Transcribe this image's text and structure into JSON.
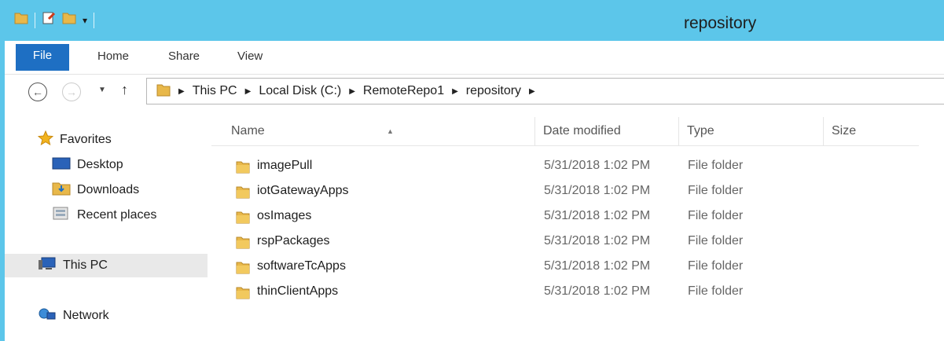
{
  "window": {
    "title": "repository"
  },
  "ribbon": {
    "tabs": [
      "File",
      "Home",
      "Share",
      "View"
    ]
  },
  "address": {
    "breadcrumb": [
      "This PC",
      "Local Disk (C:)",
      "RemoteRepo1",
      "repository"
    ]
  },
  "nav": {
    "favorites": "Favorites",
    "desktop": "Desktop",
    "downloads": "Downloads",
    "recent": "Recent places",
    "this_pc": "This PC",
    "network": "Network"
  },
  "columns": {
    "name": "Name",
    "date": "Date modified",
    "type": "Type",
    "size": "Size"
  },
  "files": [
    {
      "name": "imagePull",
      "date": "5/31/2018 1:02 PM",
      "type": "File folder"
    },
    {
      "name": "iotGatewayApps",
      "date": "5/31/2018 1:02 PM",
      "type": "File folder"
    },
    {
      "name": "osImages",
      "date": "5/31/2018 1:02 PM",
      "type": "File folder"
    },
    {
      "name": "rspPackages",
      "date": "5/31/2018 1:02 PM",
      "type": "File folder"
    },
    {
      "name": "softwareTcApps",
      "date": "5/31/2018 1:02 PM",
      "type": "File folder"
    },
    {
      "name": "thinClientApps",
      "date": "5/31/2018 1:02 PM",
      "type": "File folder"
    }
  ],
  "icons": {
    "folder": "folder-icon",
    "star": "star-icon",
    "desktop": "desktop-icon",
    "downloads": "downloads-icon",
    "recent": "recent-places-icon",
    "computer": "computer-icon",
    "network": "network-icon"
  },
  "colors": {
    "titlebar": "#5cc6ea",
    "file_tab": "#1e6fc3",
    "folder": "#e8b84a"
  }
}
